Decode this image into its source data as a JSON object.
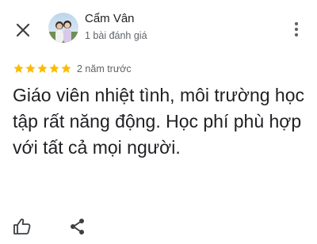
{
  "header": {
    "close_icon": "close-icon",
    "author_name": "Cẩm Vân",
    "author_meta": "1 bài đánh giá",
    "more_icon": "more-vert-icon"
  },
  "review": {
    "rating": 5,
    "rating_max": 5,
    "star_color": "#fbbc04",
    "time_ago": "2 năm trước",
    "text": "Giáo viên nhiệt tình, môi trường học tập rất năng động. Học phí phù hợp với tất cả mọi người."
  },
  "actions": {
    "like_icon": "thumb-up-icon",
    "share_icon": "share-icon"
  }
}
